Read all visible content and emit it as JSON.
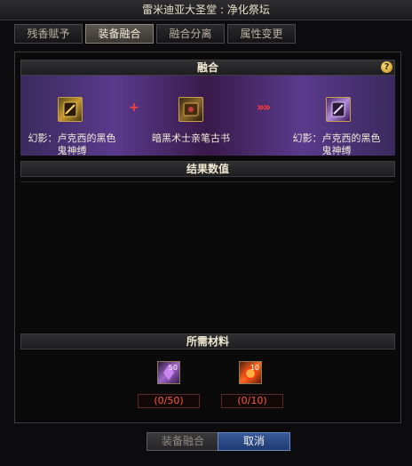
{
  "window": {
    "title": "雷米迪亚大圣堂 : 净化祭坛"
  },
  "tabs": [
    {
      "label": "残香赋予",
      "active": false
    },
    {
      "label": "装备融合",
      "active": true
    },
    {
      "label": "融合分离",
      "active": false
    },
    {
      "label": "属性变更",
      "active": false
    }
  ],
  "fusion": {
    "header": "融合",
    "help_icon": "?",
    "source_item": "幻影：卢克西的黑色鬼神缚",
    "material_item": "暗黑术士亲笔古书",
    "result_item": "幻影：卢克西的黑色鬼神缚",
    "operator": "+",
    "arrow": "»»"
  },
  "results": {
    "header": "结果数值"
  },
  "materials": {
    "header": "所需材料",
    "items": [
      {
        "icon": "purple-crystal-icon",
        "stack": "50",
        "required": "(0/50)"
      },
      {
        "icon": "red-sun-orb-icon",
        "stack": "10",
        "required": "(0/10)"
      }
    ]
  },
  "buttons": {
    "fuse": "装备融合",
    "cancel": "取消"
  },
  "colors": {
    "accent_red": "#ff4a3a",
    "gold_border": "#c8a048",
    "primary_button": "#2e4c8a"
  }
}
